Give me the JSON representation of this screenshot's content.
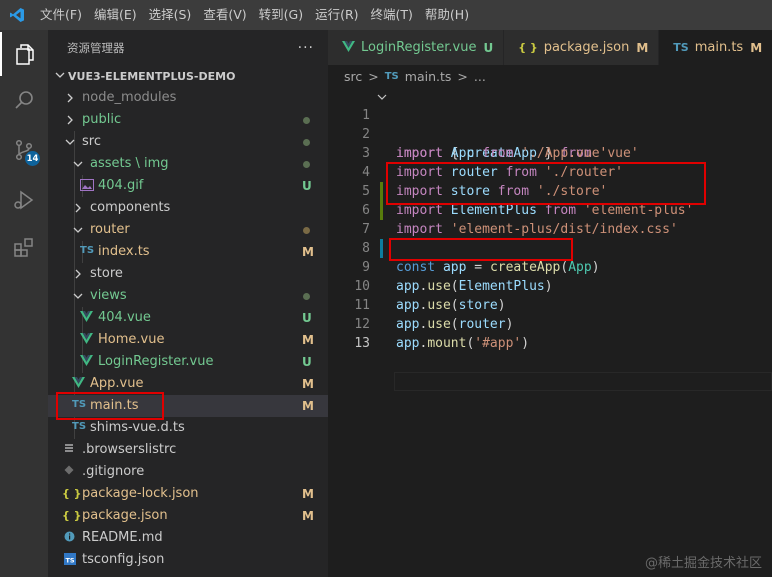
{
  "menu": [
    "文件(F)",
    "编辑(E)",
    "选择(S)",
    "查看(V)",
    "转到(G)",
    "运行(R)",
    "终端(T)",
    "帮助(H)"
  ],
  "activity": {
    "scm_badge": "14"
  },
  "sidebar": {
    "title": "资源管理器",
    "more": "···",
    "project": "VUE3-ELEMENTPLUS-DEMO",
    "items": [
      {
        "label": "node_modules",
        "status": ""
      },
      {
        "label": "public",
        "status": ""
      },
      {
        "label": "src",
        "status": ""
      },
      {
        "label": "assets \\ img",
        "status": ""
      },
      {
        "label": "404.gif",
        "status": "U"
      },
      {
        "label": "components",
        "status": ""
      },
      {
        "label": "router",
        "status": ""
      },
      {
        "label": "index.ts",
        "status": "M"
      },
      {
        "label": "store",
        "status": ""
      },
      {
        "label": "views",
        "status": ""
      },
      {
        "label": "404.vue",
        "status": "U"
      },
      {
        "label": "Home.vue",
        "status": "M"
      },
      {
        "label": "LoginRegister.vue",
        "status": "U"
      },
      {
        "label": "App.vue",
        "status": "M"
      },
      {
        "label": "main.ts",
        "status": "M"
      },
      {
        "label": "shims-vue.d.ts",
        "status": ""
      },
      {
        "label": ".browserslistrc",
        "status": ""
      },
      {
        "label": ".gitignore",
        "status": ""
      },
      {
        "label": "package-lock.json",
        "status": "M"
      },
      {
        "label": "package.json",
        "status": "M"
      },
      {
        "label": "README.md",
        "status": ""
      },
      {
        "label": "tsconfig.json",
        "status": ""
      }
    ]
  },
  "tabs": [
    {
      "label": "LoginRegister.vue",
      "status": "U"
    },
    {
      "label": "package.json",
      "status": "M"
    },
    {
      "label": "main.ts",
      "status": "M"
    }
  ],
  "breadcrumb": {
    "folder": "src",
    "sep": ">",
    "file": "main.ts",
    "more": "..."
  },
  "icons": {
    "ts": "TS",
    "json": "{ }"
  },
  "editor": {
    "line_numbers": [
      "1",
      "2",
      "3",
      "4",
      "5",
      "6",
      "7",
      "8",
      "9",
      "10",
      "11",
      "12",
      "13"
    ],
    "code": {
      "l1": [
        "import",
        " { ",
        "createApp",
        " } ",
        "from",
        " ",
        "'vue'"
      ],
      "l2": [
        "import",
        " ",
        "App",
        " ",
        "from",
        " ",
        "'./App.vue'"
      ],
      "l3": [
        "import",
        " ",
        "router",
        " ",
        "from",
        " ",
        "'./router'"
      ],
      "l4": [
        "import",
        " ",
        "store",
        " ",
        "from",
        " ",
        "'./store'"
      ],
      "l5": [
        "import",
        " ",
        "ElementPlus",
        " ",
        "from",
        " ",
        "'element-plus'"
      ],
      "l6": [
        "import",
        " ",
        "'element-plus/dist/index.css'"
      ],
      "l8": [
        "const",
        " ",
        "app",
        " = ",
        "createApp",
        "(",
        "App",
        ")"
      ],
      "l9": [
        "app",
        ".",
        "use",
        "(",
        "ElementPlus",
        ")"
      ],
      "l10": [
        "app",
        ".",
        "use",
        "(",
        "store",
        ")"
      ],
      "l11": [
        "app",
        ".",
        "use",
        "(",
        "router",
        ")"
      ],
      "l12": [
        "app",
        ".",
        "mount",
        "(",
        "'#app'",
        ")"
      ]
    }
  },
  "watermark": "@稀土掘金技术社区",
  "colors": {
    "modified": "#e2c08d",
    "untracked": "#73c991",
    "highlight": "#e00000"
  }
}
